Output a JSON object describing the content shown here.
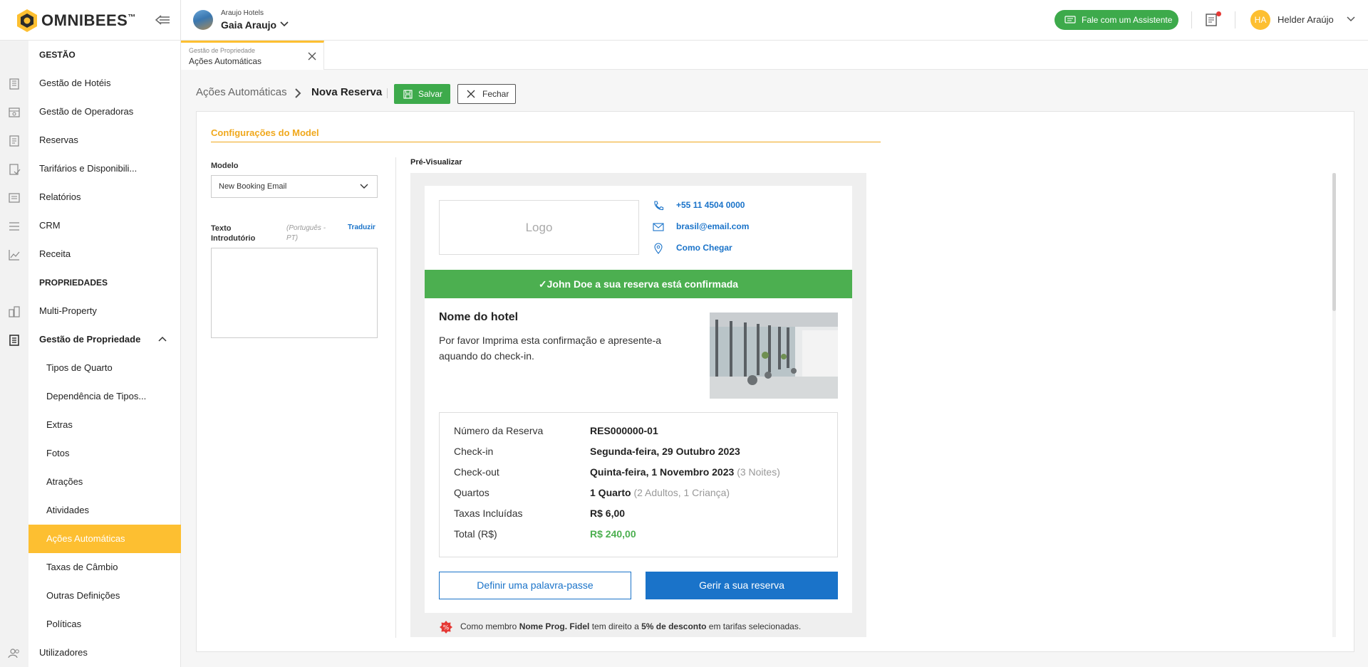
{
  "brand": {
    "name": "OMNIBEES",
    "tm": "™",
    "accent": "#fdbf31",
    "green": "#3daa4b",
    "link_blue": "#1a73c9"
  },
  "sidebar": {
    "sections": [
      {
        "label": "GESTÃO"
      },
      {
        "label": "PROPRIEDADES"
      }
    ],
    "gestao_items": [
      {
        "label": "Gestão de Hotéis",
        "icon": "building-icon"
      },
      {
        "label": "Gestão de Operadoras",
        "icon": "operator-icon"
      },
      {
        "label": "Reservas",
        "icon": "reservations-icon"
      },
      {
        "label": "Tarifários e Disponibili...",
        "icon": "rates-icon"
      },
      {
        "label": "Relatórios",
        "icon": "reports-icon"
      },
      {
        "label": "CRM",
        "icon": "crm-icon"
      },
      {
        "label": "Receita",
        "icon": "revenue-chart-icon"
      }
    ],
    "prop_items": [
      {
        "label": "Multi-Property",
        "icon": "multi-property-icon"
      },
      {
        "label": "Gestão de Propriedade",
        "icon": "property-icon"
      }
    ],
    "sub_items": [
      {
        "label": "Tipos de Quarto"
      },
      {
        "label": "Dependência de Tipos..."
      },
      {
        "label": "Extras"
      },
      {
        "label": "Fotos"
      },
      {
        "label": "Atrações"
      },
      {
        "label": "Atividades"
      },
      {
        "label": "Ações Automáticas"
      },
      {
        "label": "Taxas de Câmbio"
      },
      {
        "label": "Outras Definições"
      },
      {
        "label": "Políticas"
      }
    ],
    "bottom_item": {
      "label": "Utilizadores",
      "icon": "users-icon"
    }
  },
  "header": {
    "hotel_group": "Araujo Hotels",
    "hotel_name": "Gaia Araujo",
    "assistant_label": "Fale com um Assistente",
    "user_initials": "HA",
    "user_name": "Helder Araújo"
  },
  "tab": {
    "subtitle": "Gestão de Propriedade",
    "title": "Ações Automáticas"
  },
  "breadcrumb": {
    "parent": "Ações Automáticas",
    "current": "Nova Reserva"
  },
  "actions": {
    "save": "Salvar",
    "close": "Fechar"
  },
  "form": {
    "section_title": "Configurações do Model",
    "model_label": "Modelo",
    "model_value": "New Booking Email",
    "intro_label": "Texto Introdutório",
    "intro_lang": "(Português - PT)",
    "translate": "Traduzir",
    "intro_value": ""
  },
  "preview": {
    "label": "Pré-Visualizar",
    "logo_placeholder": "Logo",
    "phone": "+55 11 4504 0000",
    "email": "brasil@email.com",
    "directions": "Como Chegar",
    "confirmation": "✓John Doe a sua reserva está confirmada",
    "hotel_name": "Nome do hotel",
    "hotel_text": "Por favor Imprima esta confirmação e apresente-a aquando do check-in.",
    "reservation": [
      {
        "label": "Número da Reserva",
        "value": "RES000000-01",
        "extra": ""
      },
      {
        "label": "Check-in",
        "value": "Segunda-feira, 29 Outubro 2023",
        "extra": ""
      },
      {
        "label": "Check-out",
        "value": "Quinta-feira, 1 Novembro 2023",
        "extra": "(3 Noites)"
      },
      {
        "label": "Quartos",
        "value": "1 Quarto",
        "extra": "(2 Adultos, 1 Criança)"
      },
      {
        "label": "Taxas Incluídas",
        "value": "R$ 6,00",
        "extra": ""
      },
      {
        "label": "Total (R$)",
        "value": "R$ 240,00",
        "extra": ""
      }
    ],
    "btn_password": "Definir uma palavra-passe",
    "btn_manage": "Gerir a sua reserva",
    "loyalty": {
      "pre": "Como membro ",
      "program": "Nome Prog. Fidel",
      "mid": " tem direito a ",
      "discount": "5% de desconto",
      "post": " em tarifas selecionadas."
    }
  }
}
